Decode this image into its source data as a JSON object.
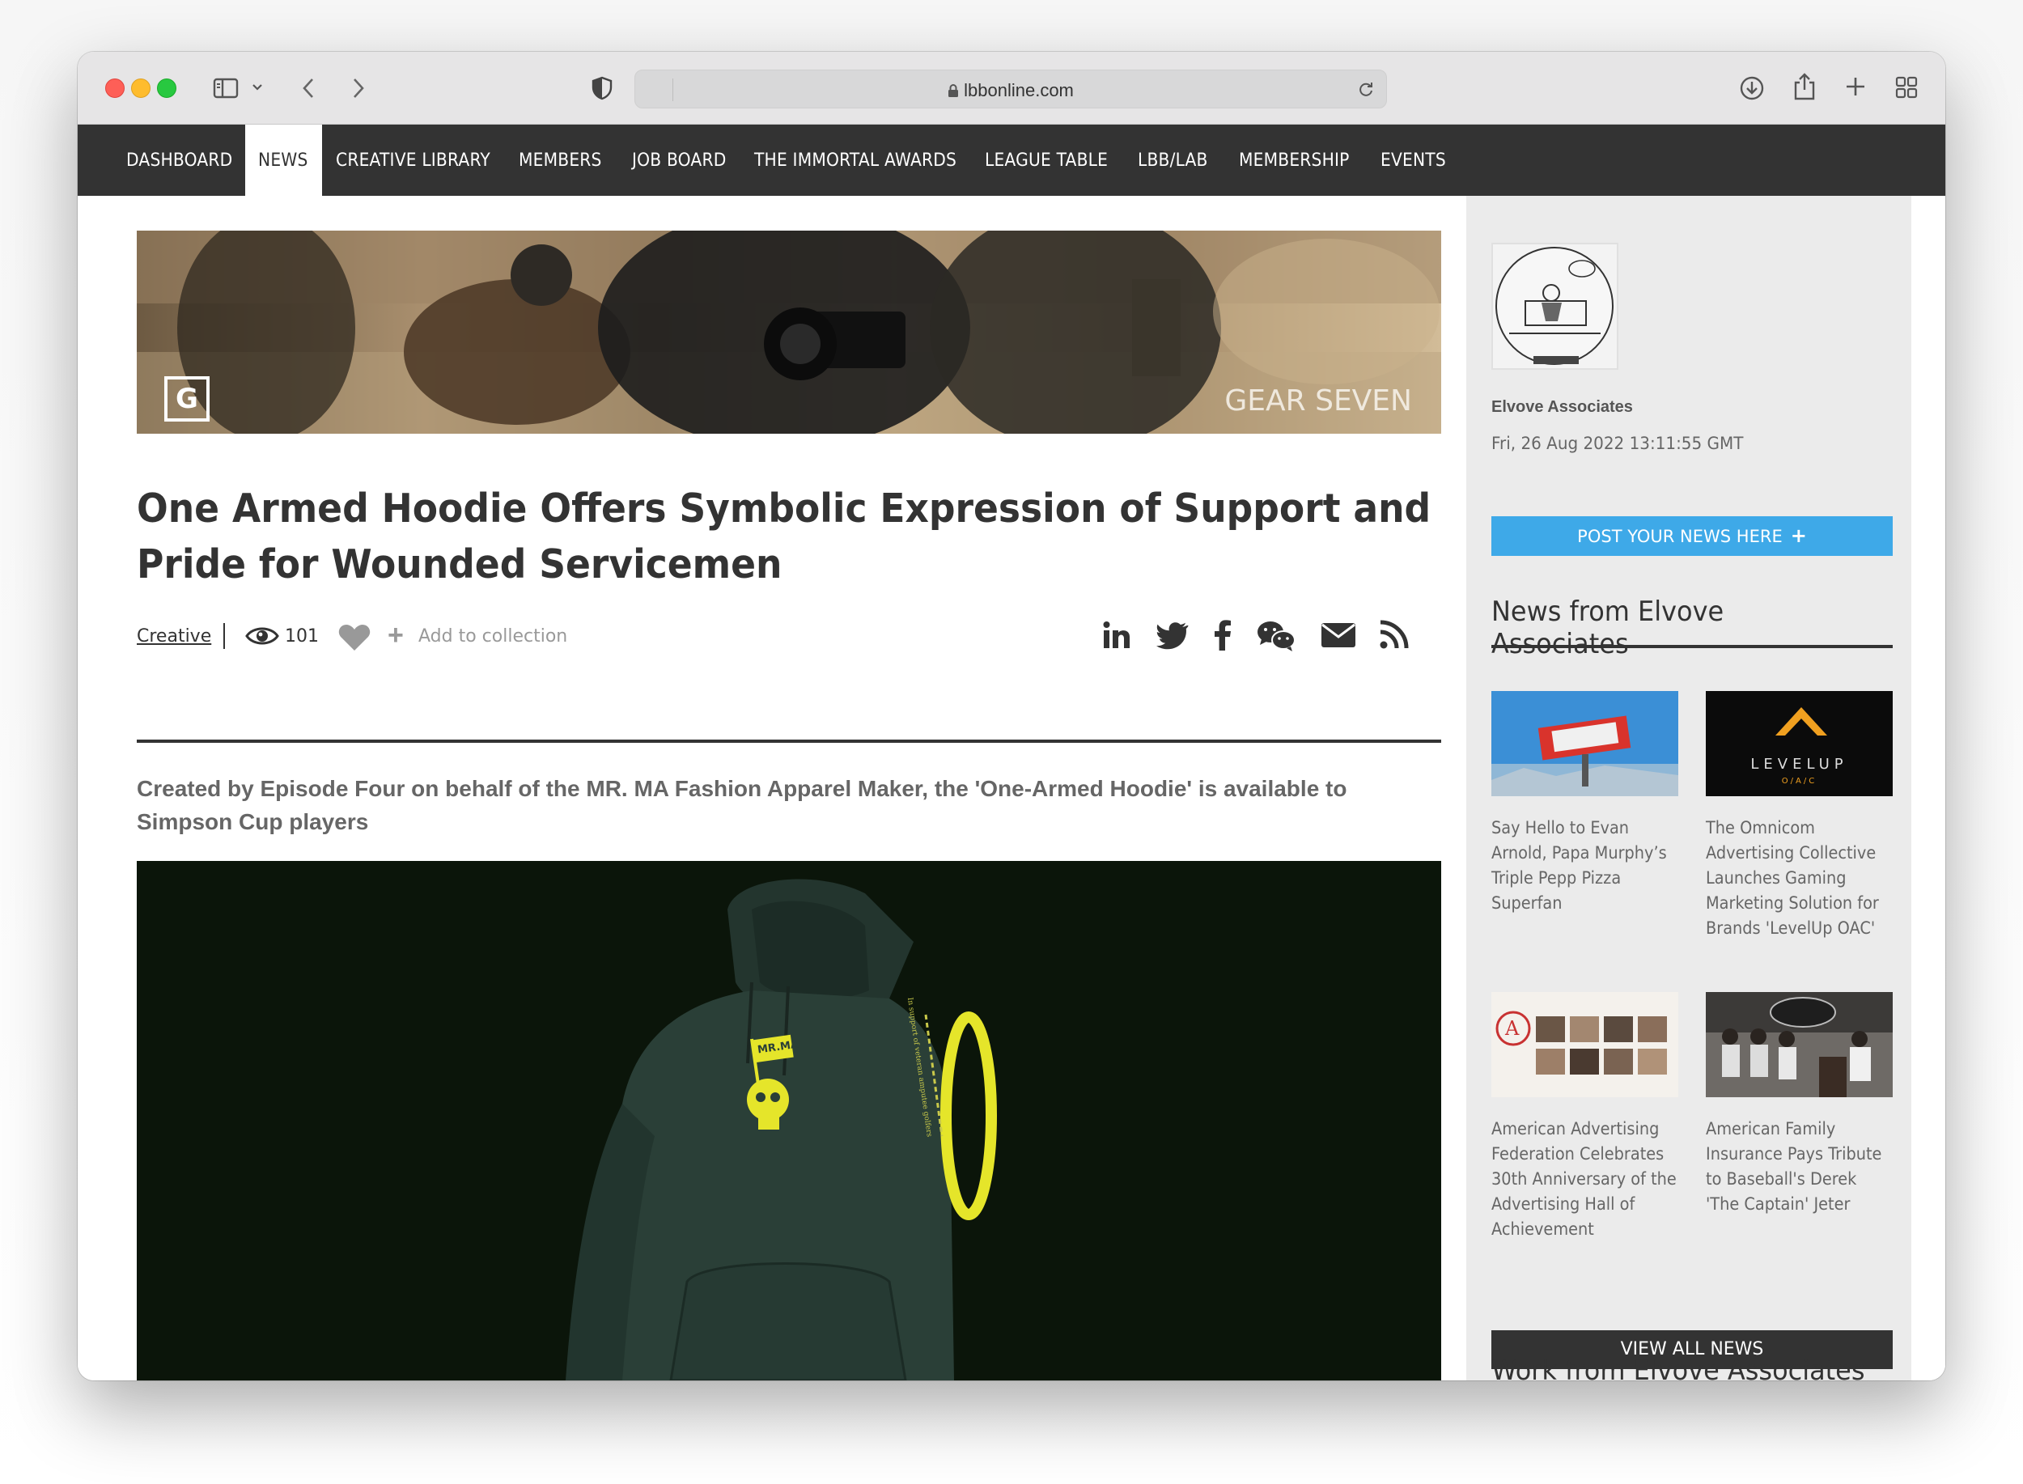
{
  "browser": {
    "url": "lbbonline.com"
  },
  "nav": {
    "items": [
      "DASHBOARD",
      "NEWS",
      "CREATIVE LIBRARY",
      "MEMBERS",
      "JOB BOARD",
      "THE IMMORTAL AWARDS",
      "LEAGUE TABLE",
      "LBB/LAB",
      "MEMBERSHIP",
      "EVENTS"
    ],
    "active": "NEWS"
  },
  "banner": {
    "brand": "GEAR SEVEN",
    "logo_letter": "G"
  },
  "article": {
    "title": "One Armed Hoodie Offers Symbolic Expression of Support and Pride for Wounded Servicemen",
    "category": "Creative",
    "views": "101",
    "add_to_collection": "Add to collection",
    "lede": "Created by Episode Four on behalf of the MR. MA Fashion Apparel Maker, the 'One-Armed Hoodie' is available to Simpson Cup players",
    "hoodie_patch_text": "MR.MA",
    "hoodie_sleeve_text": "In support of veteran amputee golfers"
  },
  "share_icons": [
    "linkedin-icon",
    "twitter-icon",
    "facebook-icon",
    "wechat-icon",
    "email-icon",
    "rss-icon"
  ],
  "sidebar": {
    "company": "Elvove Associates",
    "date": "Fri, 26 Aug 2022 13:11:55 GMT",
    "post_button": "POST YOUR NEWS HERE",
    "post_button_icon": "+",
    "news_heading": "News from Elvove Associates",
    "news": [
      {
        "title": "Say Hello to Evan Arnold, Papa Murphy’s Triple Pepp Pizza Superfan"
      },
      {
        "title": "The Omnicom Advertising Collective Launches Gaming Marketing Solution for Brands 'LevelUp OAC'"
      },
      {
        "title": "American Advertising Federation Celebrates 30th Anniversary of the Advertising Hall of Achievement"
      },
      {
        "title": "American Family Insurance Pays Tribute to Baseball's Derek 'The Captain' Jeter"
      }
    ],
    "view_all": "VIEW ALL NEWS",
    "work_heading": "Work from Elvove Associates",
    "thumb_levelup": "LEVELUP",
    "thumb_levelup_sub": "O/A/C",
    "thumb_aaf_letter": "A"
  },
  "colors": {
    "nav_bg": "#333333",
    "accent_blue": "#3ea9e8",
    "sidebar_bg": "#ebebeb",
    "hoodie_accent": "#e5e52a"
  }
}
